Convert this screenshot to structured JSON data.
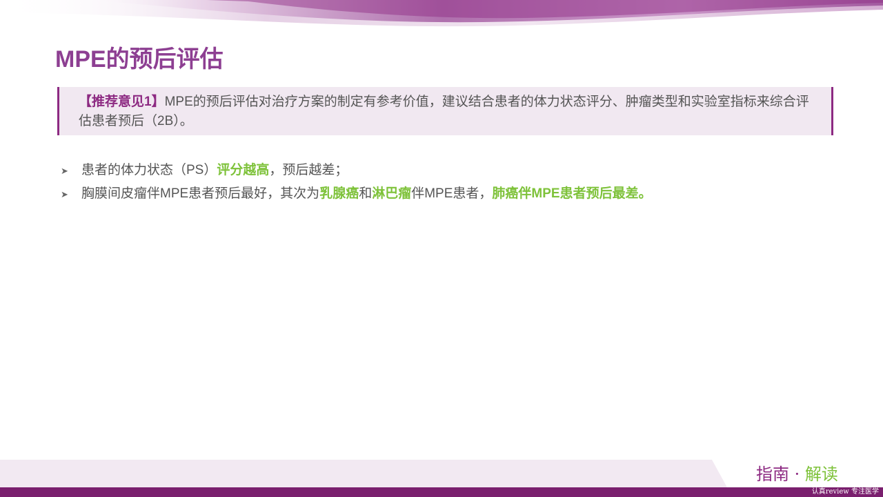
{
  "title": "MPE的预后评估",
  "recommendation": {
    "tag": "【推荐意见1】",
    "text": "MPE的预后评估对治疗方案的制定有参考价值，建议结合患者的体力状态评分、肿瘤类型和实验室指标来综合评估患者预后（2B）。"
  },
  "bullets": [
    {
      "s1": "患者的体力状态（PS）",
      "h1": "评分越高",
      "s2": "，预后越差；"
    },
    {
      "s1": "胸膜间皮瘤伴MPE患者预后最好，其次为",
      "h1": "乳腺癌",
      "s2": "和",
      "h2": "淋巴瘤",
      "s3": "伴MPE患者，",
      "h3": "肺癌伴MPE患者预后最差。"
    }
  ],
  "footer": {
    "logo_a": "指南",
    "logo_dot": " · ",
    "logo_b": "解读",
    "watermark": "认真review 专注医学"
  },
  "colors": {
    "title": "#8d3f92",
    "accent": "#8d2a82",
    "highlight": "#7ec23a",
    "box_bg": "#f1e8f1"
  }
}
